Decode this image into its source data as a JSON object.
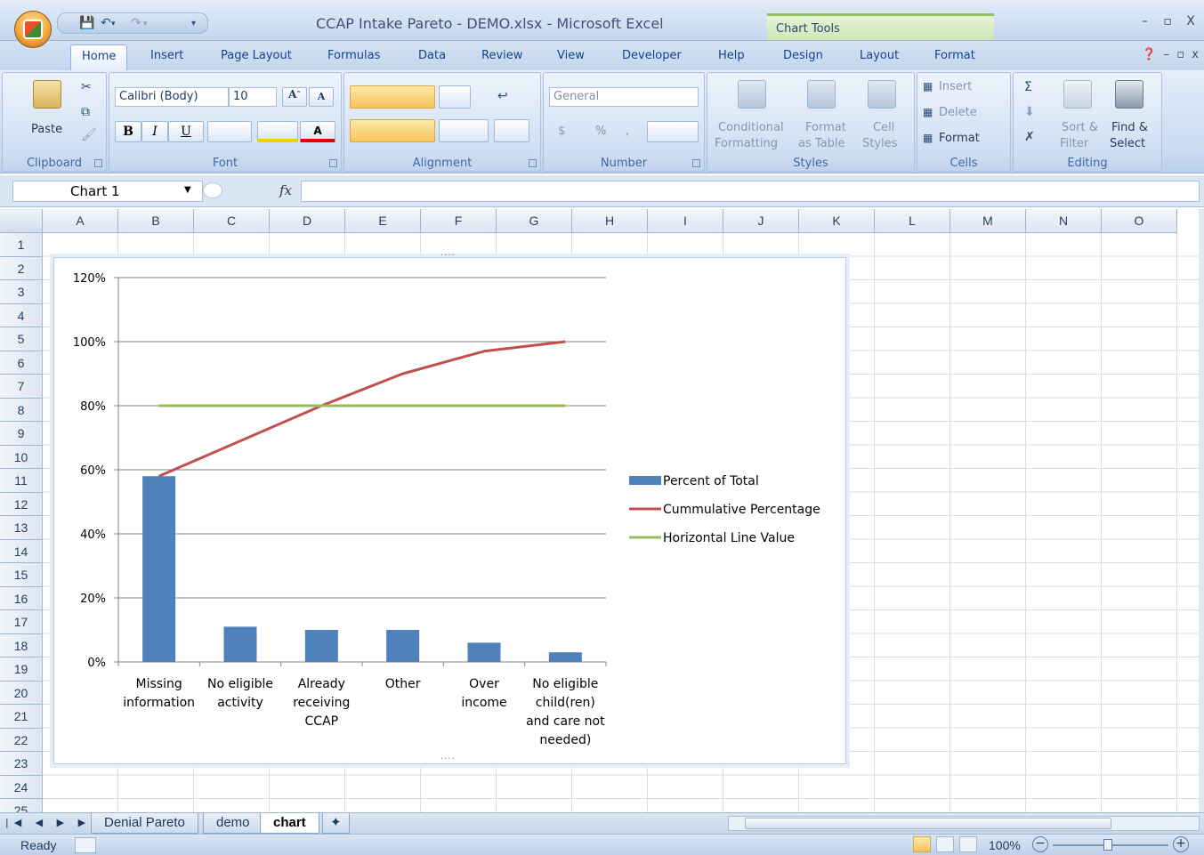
{
  "window": {
    "title": "CCAP Intake Pareto - DEMO.xlsx - Microsoft Excel",
    "context_tab": "Chart Tools",
    "controls": [
      "–",
      "▫",
      "X"
    ]
  },
  "tabs": [
    "Home",
    "Insert",
    "Page Layout",
    "Formulas",
    "Data",
    "Review",
    "View",
    "Developer",
    "Help",
    "Design",
    "Layout",
    "Format"
  ],
  "active_tab": "Home",
  "ribbon": {
    "clipboard": {
      "label": "Clipboard",
      "paste": "Paste"
    },
    "font": {
      "label": "Font",
      "family": "Calibri (Body)",
      "size": "10",
      "bold": "B",
      "italic": "I",
      "underline": "U"
    },
    "alignment": {
      "label": "Alignment"
    },
    "number": {
      "label": "Number",
      "format": "General",
      "currency": "$",
      "percent": "%",
      "comma": ","
    },
    "styles": {
      "label": "Styles",
      "conditional_1": "Conditional",
      "conditional_2": "Formatting",
      "format_table_1": "Format",
      "format_table_2": "as Table",
      "cell_styles_1": "Cell",
      "cell_styles_2": "Styles"
    },
    "cells": {
      "label": "Cells",
      "insert": "Insert",
      "delete": "Delete",
      "format": "Format"
    },
    "editing": {
      "label": "Editing",
      "sort_1": "Sort &",
      "sort_2": "Filter",
      "find_1": "Find &",
      "find_2": "Select"
    }
  },
  "formula_bar": {
    "name_box": "Chart 1",
    "fx": "fx",
    "formula": ""
  },
  "columns": [
    "A",
    "B",
    "C",
    "D",
    "E",
    "F",
    "G",
    "H",
    "I",
    "J",
    "K",
    "L",
    "M",
    "N",
    "O"
  ],
  "rows": [
    "1",
    "2",
    "3",
    "4",
    "5",
    "6",
    "7",
    "8",
    "9",
    "10",
    "11",
    "12",
    "13",
    "14",
    "15",
    "16",
    "17",
    "18",
    "19",
    "20",
    "21",
    "22",
    "23",
    "24",
    "25"
  ],
  "chart_data": {
    "type": "bar",
    "categories": [
      [
        "Missing",
        "information"
      ],
      [
        "No eligible",
        "activity"
      ],
      [
        "Already",
        "receiving",
        "CCAP"
      ],
      [
        "Other"
      ],
      [
        "Over",
        "income"
      ],
      [
        "No eligible",
        "child(ren)",
        "and care not",
        "needed)"
      ]
    ],
    "series": [
      {
        "name": "Percent of Total",
        "type": "bar",
        "color": "#4f81bd",
        "values": [
          58,
          11,
          10,
          10,
          6,
          3
        ]
      },
      {
        "name": "Cummulative Percentage",
        "type": "line",
        "color": "#c0504d",
        "values": [
          58,
          69,
          80,
          90,
          97,
          100
        ]
      },
      {
        "name": "Horizontal Line Value",
        "type": "line",
        "color": "#9bbb59",
        "values": [
          80,
          80,
          80,
          80,
          80,
          80
        ]
      }
    ],
    "ylim": [
      0,
      120
    ],
    "yticks": [
      "0%",
      "20%",
      "40%",
      "60%",
      "80%",
      "100%",
      "120%"
    ],
    "grid": true,
    "legend": "right"
  },
  "sheets": [
    "Denial Pareto",
    "demo",
    "chart"
  ],
  "active_sheet": "chart",
  "status": {
    "ready": "Ready",
    "zoom": "100%"
  }
}
